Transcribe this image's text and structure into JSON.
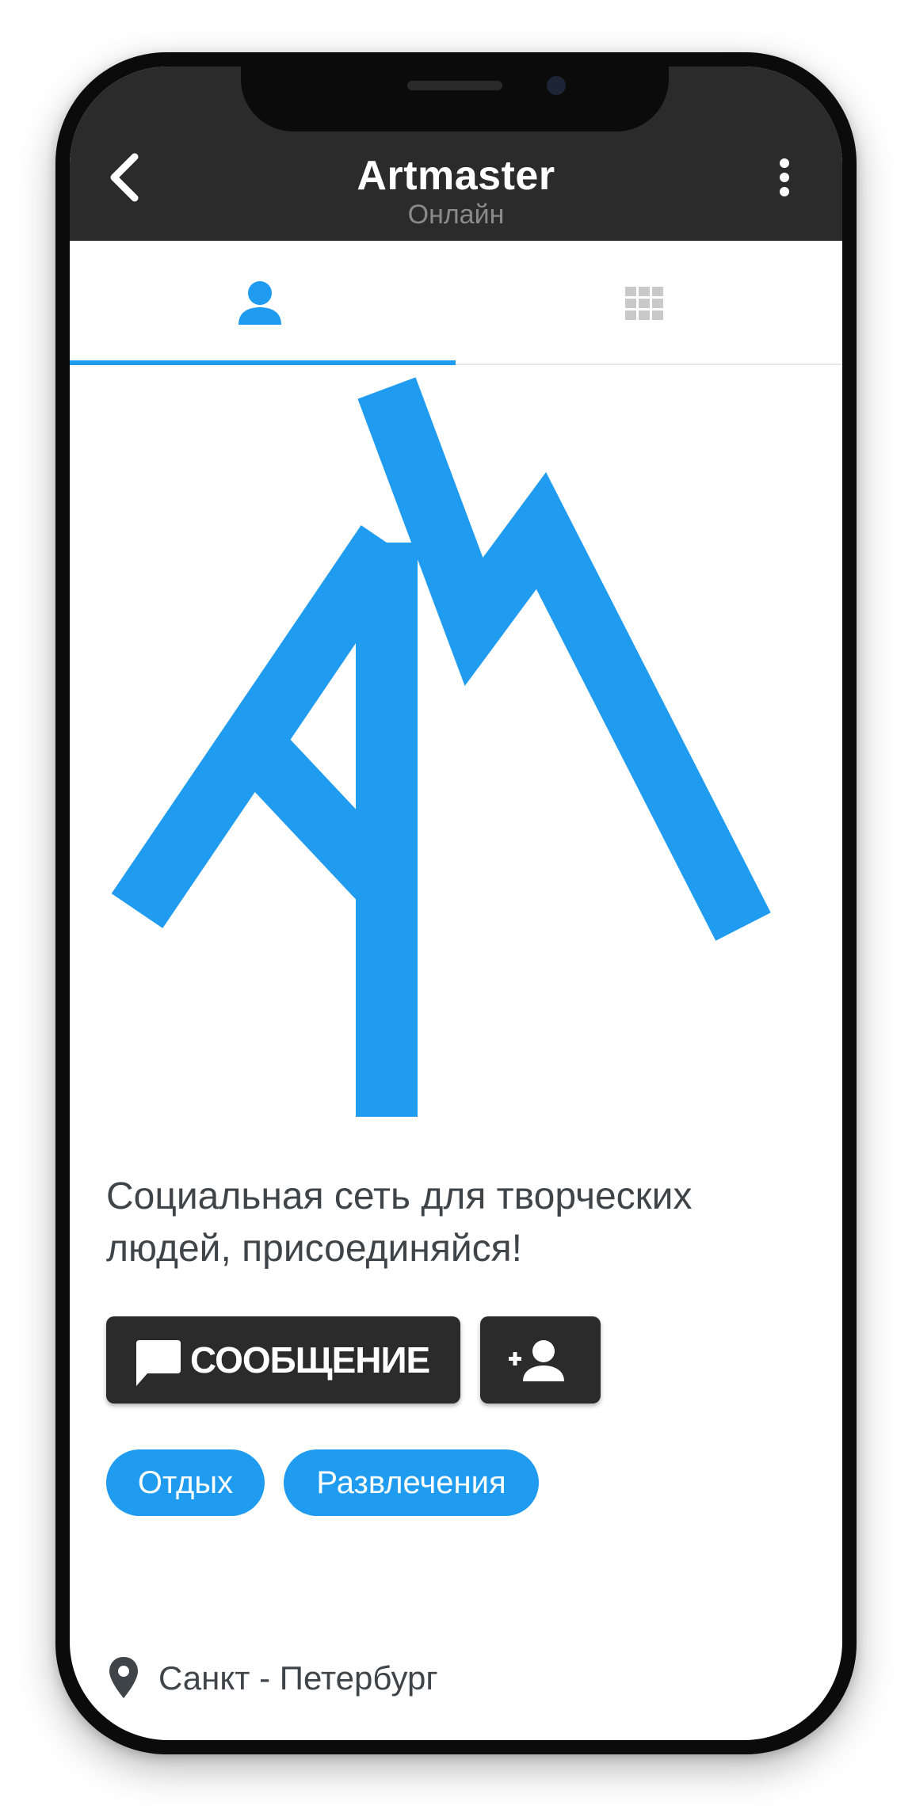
{
  "header": {
    "title": "Artmaster",
    "status": "Онлайн"
  },
  "tabs": [
    {
      "icon": "person-icon",
      "active": true
    },
    {
      "icon": "grid-icon",
      "active": false
    }
  ],
  "profile": {
    "description": "Социальная сеть для творческих людей, присоединяйся!",
    "message_button_label": "СООБЩЕНИЕ",
    "tags": [
      "Отдых",
      "Развлечения"
    ],
    "location": "Санкт - Петербург"
  },
  "colors": {
    "accent": "#1f9bef",
    "appbar": "#2b2b2b",
    "text": "#3f4448",
    "muted": "#8a8a8a"
  }
}
